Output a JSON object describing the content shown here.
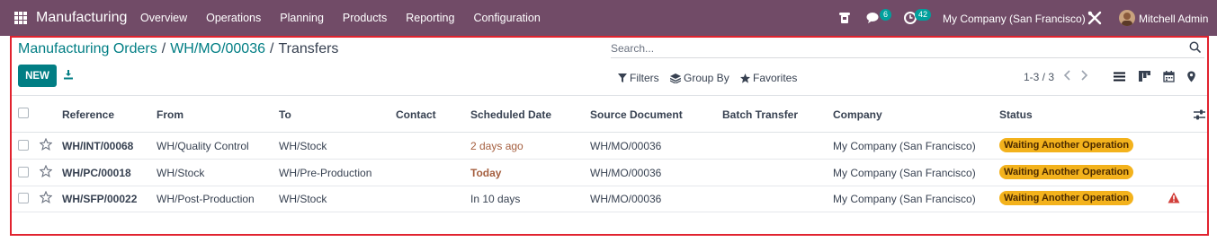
{
  "navbar": {
    "app_name": "Manufacturing",
    "menu": [
      "Overview",
      "Operations",
      "Planning",
      "Products",
      "Reporting",
      "Configuration"
    ],
    "chat_count": "6",
    "activity_count": "42",
    "company": "My Company (San Francisco)",
    "user": "Mitchell Admin",
    "bg_color": "#714b67"
  },
  "breadcrumb": {
    "items": [
      "Manufacturing Orders",
      "WH/MO/00036"
    ],
    "current": "Transfers",
    "separator": "/"
  },
  "search": {
    "placeholder": "Search..."
  },
  "toolbar": {
    "new_label": "NEW",
    "filters_label": "Filters",
    "groupby_label": "Group By",
    "favorites_label": "Favorites",
    "pager": "1-3 / 3"
  },
  "table": {
    "columns": [
      "Reference",
      "From",
      "To",
      "Contact",
      "Scheduled Date",
      "Source Document",
      "Batch Transfer",
      "Company",
      "Status"
    ],
    "rows": [
      {
        "reference": "WH/INT/00068",
        "from": "WH/Quality Control",
        "to": "WH/Stock",
        "contact": "",
        "scheduled": "2 days ago",
        "source": "WH/MO/00036",
        "batch": "",
        "company": "My Company (San Francisco)",
        "status": "Waiting Another Operation",
        "warning": false
      },
      {
        "reference": "WH/PC/00018",
        "from": "WH/Stock",
        "to": "WH/Pre-Production",
        "contact": "",
        "scheduled": "Today",
        "source": "WH/MO/00036",
        "batch": "",
        "company": "My Company (San Francisco)",
        "status": "Waiting Another Operation",
        "warning": false
      },
      {
        "reference": "WH/SFP/00022",
        "from": "WH/Post-Production",
        "to": "WH/Stock",
        "contact": "",
        "scheduled": "In 10 days",
        "source": "WH/MO/00036",
        "batch": "",
        "company": "My Company (San Francisco)",
        "status": "Waiting Another Operation",
        "warning": true
      }
    ]
  },
  "colors": {
    "accent": "#017e84",
    "status_badge": "#f3b21c",
    "highlight_frame": "#e1232f",
    "warning": "#d23f3a"
  }
}
